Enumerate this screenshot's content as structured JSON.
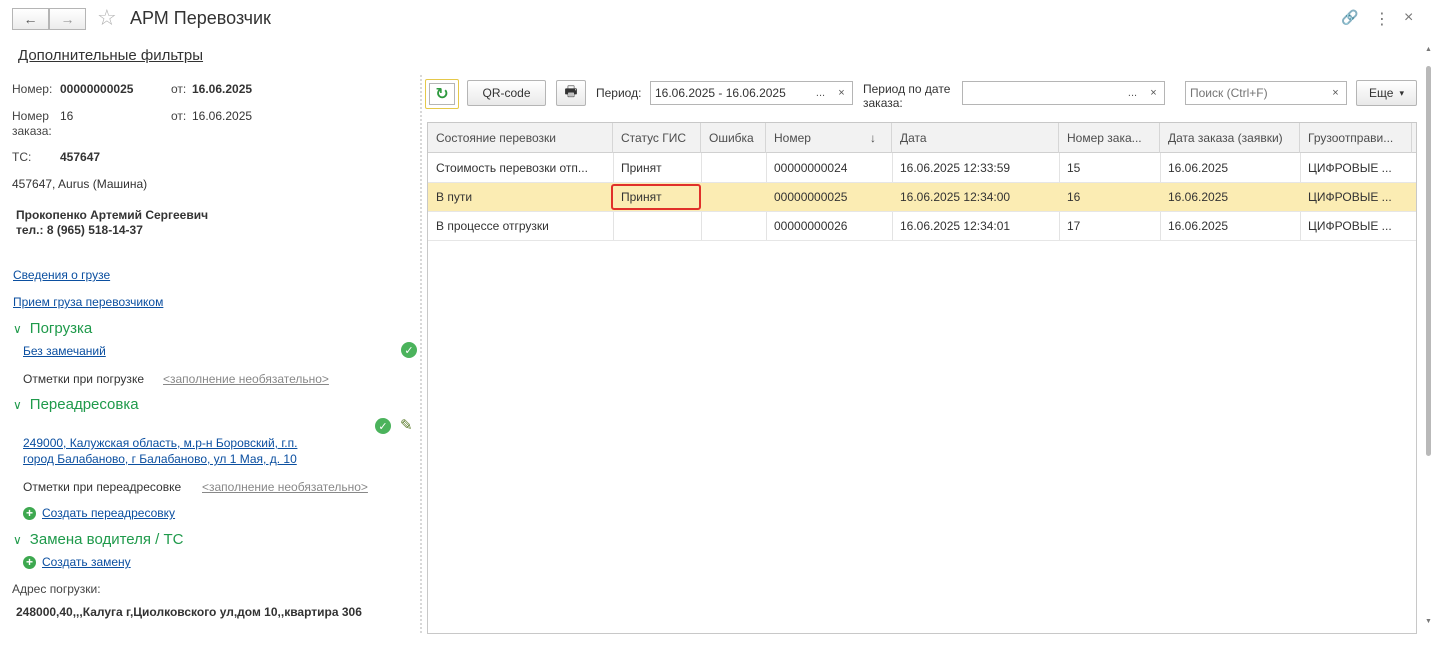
{
  "window": {
    "title": "АРМ Перевозчик",
    "back_icon": "←",
    "forward_icon": "→",
    "star_icon": "☆",
    "link_icon": "🔗",
    "more_icon": "⋮",
    "close_icon": "×"
  },
  "left": {
    "filters_link": "Дополнительные фильтры",
    "number_label": "Номер:",
    "number_value": "00000000025",
    "from_label": "от:",
    "number_date": "16.06.2025",
    "order_label_1": "Номер",
    "order_label_2": "заказа:",
    "order_value": "16",
    "order_from_label": "от:",
    "order_date": "16.06.2025",
    "ts_label": "ТС:",
    "ts_value": "457647",
    "vehicle": "457647, Aurus (Машина)",
    "driver_name": "Прокопенко Артемий Сергеевич",
    "driver_phone": "тел.: 8 (965) 518-14-37",
    "cargo_info_link": "Сведения о грузе",
    "cargo_accept_link": "Прием груза перевозчиком",
    "loading_section": "Погрузка",
    "loading_status_link": "Без замечаний",
    "loading_marks_label": "Отметки при погрузке",
    "loading_marks_hint": "<заполнение необязательно>",
    "redirect_section": "Переадресовка",
    "redirect_address_line1": "249000, Калужская область, м.р-н Боровский, г.п.",
    "redirect_address_line2": "город Балабаново, г Балабаново, ул 1 Мая, д. 10",
    "redirect_marks_label": "Отметки при переадресовке",
    "redirect_marks_hint": "<заполнение необязательно>",
    "create_redirect_link": "Создать переадресовку",
    "replace_section": "Замена водителя / ТС",
    "create_replace_link": "Создать замену",
    "load_address_label": "Адрес погрузки:",
    "load_address_value": "248000,40,,,Калуга г,Циолковского ул,дом 10,,квартира 306",
    "chevron_icon": "∨",
    "check_icon": "✓",
    "pencil_icon": "✎",
    "plus_icon": "+"
  },
  "toolbar": {
    "refresh_icon": "↻",
    "qr_label": "QR-code",
    "print_icon": "🖶",
    "period_label": "Период:",
    "period_value": "16.06.2025 - 16.06.2025",
    "period_select": "...",
    "period_clear": "×",
    "order_period_label_1": "Период по дате",
    "order_period_label_2": "заказа:",
    "order_period_value": "",
    "order_period_select": "...",
    "order_period_clear": "×",
    "search_placeholder": "Поиск (Ctrl+F)",
    "search_clear": "×",
    "more_label": "Еще",
    "more_arrow": "▾"
  },
  "table": {
    "columns": [
      "Состояние перевозки",
      "Статус ГИС",
      "Ошибка",
      "Номер",
      "Дата",
      "Номер зака...",
      "Дата заказа (заявки)",
      "Грузоотправи..."
    ],
    "sort_icon": "↓",
    "rows": [
      [
        "Стоимость перевозки отп...",
        "Принят",
        "",
        "00000000024",
        "16.06.2025 12:33:59",
        "15",
        "16.06.2025",
        "ЦИФРОВЫЕ ..."
      ],
      [
        "В пути",
        "Принят",
        "",
        "00000000025",
        "16.06.2025 12:34:00",
        "16",
        "16.06.2025",
        "ЦИФРОВЫЕ ..."
      ],
      [
        "В процессе отгрузки",
        "",
        "",
        "00000000026",
        "16.06.2025 12:34:01",
        "17",
        "16.06.2025",
        "ЦИФРОВЫЕ ..."
      ]
    ]
  },
  "colors": {
    "accent_green": "#1f9a4b",
    "link_blue": "#0b4fa0",
    "selected_row": "#fbecb3",
    "highlight_box": "#e0302a"
  }
}
